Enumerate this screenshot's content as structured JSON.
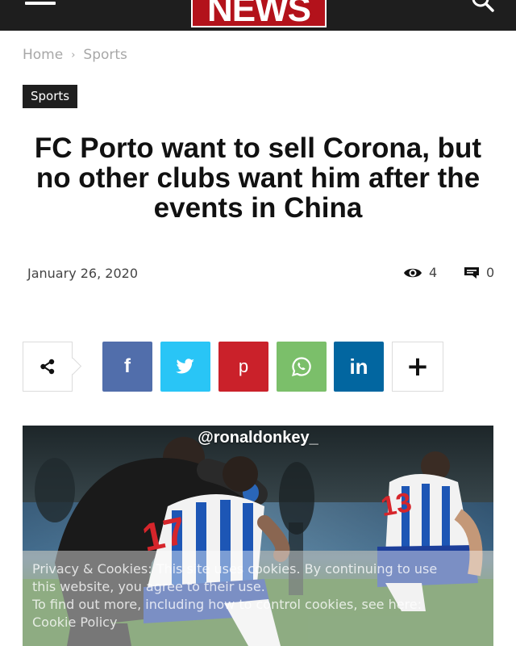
{
  "header": {
    "logo_text": "NEWS",
    "menu_icon": "hamburger-menu-icon",
    "search_icon": "search-icon",
    "brand_color": "#b3121b"
  },
  "breadcrumb": {
    "home": "Home",
    "separator": "›",
    "current": "Sports"
  },
  "article": {
    "category": "Sports",
    "title": "FC Porto want to sell Corona, but no other clubs want him after the events in China",
    "date": "January 26, 2020",
    "views": "4",
    "comments": "0"
  },
  "share": {
    "buttons": [
      {
        "name": "facebook",
        "label": "f",
        "color": "#516eab"
      },
      {
        "name": "twitter",
        "icon": "twitter-bird-icon",
        "color": "#29c5f6"
      },
      {
        "name": "pinterest",
        "label": "p",
        "color": "#ca212a"
      },
      {
        "name": "whatsapp",
        "icon": "whatsapp-icon",
        "color": "#7bbf6a"
      },
      {
        "name": "linkedin",
        "label": "in",
        "color": "#0266a0"
      },
      {
        "name": "more",
        "label": "+"
      }
    ]
  },
  "image": {
    "watermark": "@ronaldonkey_"
  },
  "cookie_notice": {
    "line1": "Privacy & Cookies: This site uses cookies. By continuing to use",
    "line2": "this website, you agree to their use.",
    "line3": "To find out more, including how to control cookies, see here:",
    "line4": "Cookie Policy"
  }
}
